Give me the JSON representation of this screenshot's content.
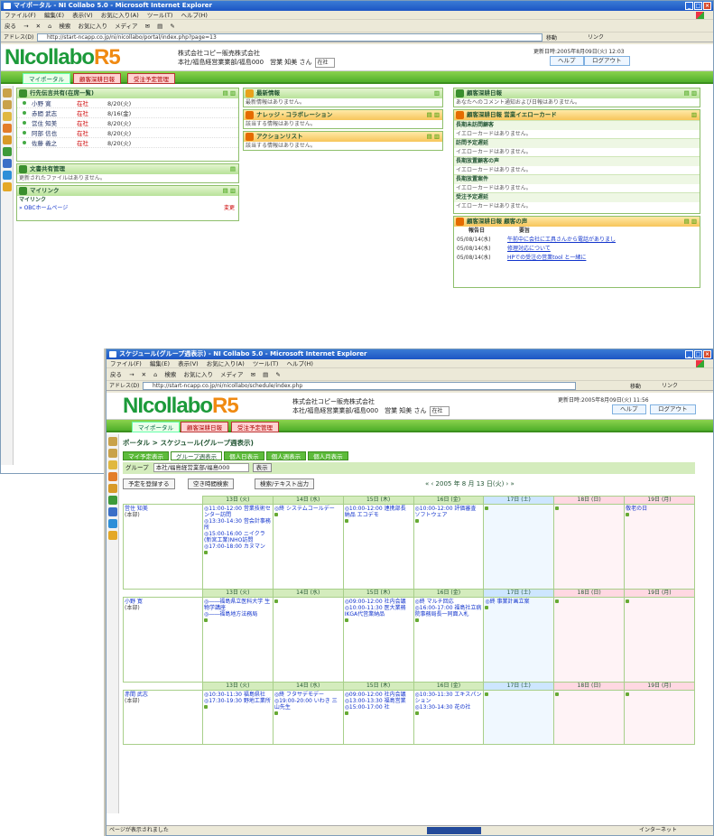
{
  "win1": {
    "title": "マイポータル - NI Collabo 5.0 - Microsoft Internet Explorer",
    "menu": [
      "ファイル(F)",
      "編集(E)",
      "表示(V)",
      "お気に入り(A)",
      "ツール(T)",
      "ヘルプ(H)"
    ],
    "toolbar": [
      "戻る",
      "→",
      "✕",
      "⌂",
      "検索",
      "お気に入り",
      "メディア",
      "✉",
      "▤",
      "✎"
    ],
    "address_label": "アドレス(D)",
    "address": "http://start-ncapp.co.jp/ni/nicollabo/portal/index.php?page=13",
    "go": "移動",
    "links": "リンク",
    "company": "株式会社コピー販売株式会社",
    "dept": "本社/福島経営業業部/福島000　営業 知美 さん",
    "dept_select": "在社",
    "update": "更新日時:2005年8月09日(火) 12:03",
    "help": "ヘルプ",
    "logout": "ログアウト",
    "tabs": [
      "マイポータル",
      "顧客深耕日報",
      "受注予定管理"
    ],
    "p_attendance": {
      "title": "行先伝言共有(在席一覧)",
      "rows": [
        {
          "name": "小野 寛",
          "status": "在社",
          "date": "8/20(火)"
        },
        {
          "name": "赤間 武志",
          "status": "在社",
          "date": "8/16(金)"
        },
        {
          "name": "営住 知美",
          "status": "在社",
          "date": "8/20(火)"
        },
        {
          "name": "阿部 信也",
          "status": "在社",
          "date": "8/20(火)"
        },
        {
          "name": "佐藤 義之",
          "status": "在社",
          "date": "8/20(火)"
        }
      ]
    },
    "p_docs": {
      "title": "文書共有管理",
      "body": "更新されたファイルはありません。"
    },
    "p_mylink": {
      "title": "マイリンク",
      "sub": "マイリンク",
      "link": "» OBCホームページ",
      "edit": "変更"
    },
    "p_news": {
      "title": "最新情報",
      "body": "最新情報はありません。"
    },
    "p_knowledge": {
      "title": "ナレッジ・コラボレーション",
      "body": "該当する情報はありません。"
    },
    "p_action": {
      "title": "アクションリスト",
      "body": "該当する情報はありません。"
    },
    "p_daily": {
      "title": "顧客深耕日報",
      "body": "あなたへのコメント通知および日報はありません。"
    },
    "p_yellow": {
      "title": "顧客深耕日報 営業イエローカード",
      "sections": [
        {
          "label": "長期未訪問顧客",
          "body": "イエローカードはありません。"
        },
        {
          "label": "訪問予定遅延",
          "body": "イエローカードはありません。"
        },
        {
          "label": "長期放置顧客の声",
          "body": "イエローカードはありません。"
        },
        {
          "label": "長期放置案件",
          "body": "イエローカードはありません。"
        },
        {
          "label": "受注予定遅延",
          "body": "イエローカードはありません。"
        }
      ]
    },
    "p_voice": {
      "title": "顧客深耕日報 顧客の声",
      "h_date": "報告日",
      "h_body": "要旨",
      "rows": [
        {
          "date": "05/08/14(水)",
          "text": "午前中に会社に工具さんから電話がありまし"
        },
        {
          "date": "05/08/14(水)",
          "text": "修理対応について"
        },
        {
          "date": "05/08/14(水)",
          "text": "HPでの受注の営業tool と一緒に"
        }
      ]
    }
  },
  "win2": {
    "title": "スケジュール(グループ週表示) - NI Collabo 5.0 - Microsoft Internet Explorer",
    "address": "http://start-ncapp.co.jp/ni/nicollabo/schedule/index.php",
    "update": "更新日時:2005年8月09日(火) 11:56",
    "breadcrumb": "ポータル > スケジュール(グループ週表示)",
    "view_tabs": [
      "マイ予定表示",
      "グループ週表示",
      "個人日表示",
      "個人週表示",
      "個人月表示"
    ],
    "group_label": "グループ",
    "group_value": "本社/福島経営業部/福島000",
    "group_btn": "表示",
    "btn_register": "予定を登録する",
    "btn_free": "空き時間検索",
    "btn_search": "検索/テキスト出力",
    "nav": "« ‹ 2005 年 8 月 13 日(火) › »",
    "days": [
      "13日 (火)",
      "14日 (水)",
      "15日 (木)",
      "16日 (金)",
      "17日 (土)",
      "18日 (日)",
      "19日 (月)"
    ],
    "members": [
      {
        "name": "営住 知美",
        "sub": "(本部)",
        "cells": [
          [
            "◎11:00-12:00 営業技術センター訪問",
            "◎13:30-14:30 営会計事務所",
            "◎15:00-16:00 ニイクラ(新宮工業)NHO訪問",
            "◎17:00-18:00 カヌマン"
          ],
          [
            "◎終 システムコールデー"
          ],
          [
            "◎10:00-12:00 連携部長 納品 エコデモ"
          ],
          [
            "◎10:00-12:00 評価審査 ソフトウェア"
          ],
          [],
          [],
          [
            "敬老の日"
          ]
        ]
      },
      {
        "name": "小野 寛",
        "sub": "(本部)",
        "cells": [
          [
            "◎――福島県立医科大学 生物学講座",
            "◎――福島地方法務局"
          ],
          [],
          [
            "◎09:00-12:00 社内会議",
            "◎10:00-11:30 医大業務IKGA代営業納品"
          ],
          [
            "◎終 マルチ回応",
            "◎16:00-17:00 福島社立病院事務局長一同面入札"
          ],
          [
            "◎終 事業計画立案"
          ],
          [],
          []
        ]
      },
      {
        "name": "赤間 武志",
        "sub": "(本部)",
        "cells": [
          [
            "◎10:30-11:30 福島県社",
            "◎17:30-19:30 野地工業所"
          ],
          [
            "◎終 フタサデモデー",
            "◎19:00-20:00 いわき 三山先生"
          ],
          [
            "◎09:00-12:00 社内会議",
            "◎13:00-13:30 福島営業",
            "◎15:00-17:00 社"
          ],
          [
            "◎10:30-11:30 エキスパンション",
            "◎13:30-14:30 花の社"
          ],
          [],
          [],
          []
        ]
      }
    ],
    "status_left": "ページが表示されました",
    "status_right": "インターネット"
  }
}
